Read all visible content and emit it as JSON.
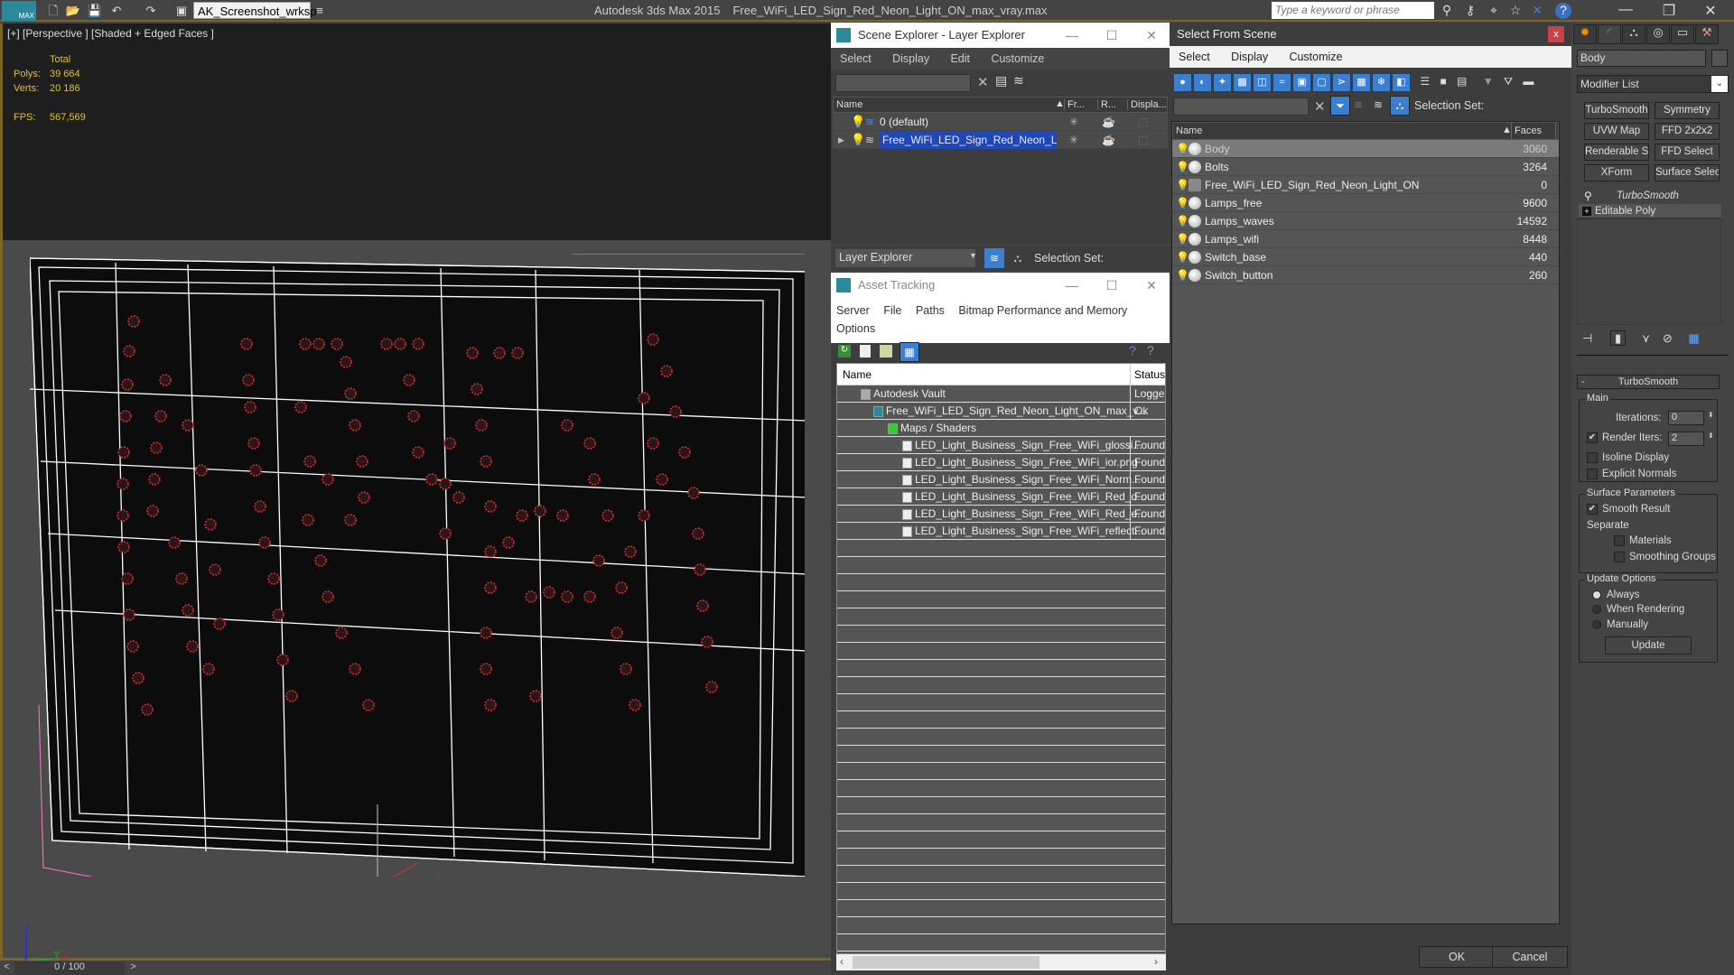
{
  "titlebar": {
    "logo_text": "MAX",
    "workspace": "AK_Screenshot_wrksp",
    "app_name": "Autodesk 3ds Max  2015",
    "file_name": "Free_WiFi_LED_Sign_Red_Neon_Light_ON_max_vray.max",
    "search_placeholder": "Type a keyword or phrase"
  },
  "viewport": {
    "label": "[+] [Perspective ] [Shaded + Edged Faces ]",
    "stats": {
      "total_label": "Total",
      "polys_label": "Polys:",
      "polys": "39 664",
      "verts_label": "Verts:",
      "verts": "20 186",
      "fps_label": "FPS:",
      "fps": "567,569"
    },
    "axis": {
      "x": "X",
      "y": "Y",
      "z": "Z"
    }
  },
  "timeline": {
    "prev": "<",
    "position": "0 / 100",
    "next": ">"
  },
  "scene_explorer": {
    "title": "Scene Explorer - Layer Explorer",
    "menu": [
      "Select",
      "Display",
      "Edit",
      "Customize"
    ],
    "columns": [
      "Name",
      "Fr...",
      "R...",
      "Displa..."
    ],
    "rows": [
      {
        "name": "0 (default)",
        "selected": false
      },
      {
        "name": "Free_WiFi_LED_Sign_Red_Neon_Ligh...",
        "selected": true
      }
    ],
    "explorer_type": "Layer Explorer",
    "selection_set_label": "Selection Set:"
  },
  "asset_tracking": {
    "title": "Asset Tracking",
    "menu": [
      "Server",
      "File",
      "Paths",
      "Bitmap Performance and Memory",
      "Options"
    ],
    "columns": [
      "Name",
      "Status"
    ],
    "rows": [
      {
        "name": "Autodesk Vault",
        "status": "Logge",
        "level": 0
      },
      {
        "name": "Free_WiFi_LED_Sign_Red_Neon_Light_ON_max_v...",
        "status": "Ok",
        "level": 1
      },
      {
        "name": "Maps / Shaders",
        "status": "",
        "level": 2
      },
      {
        "name": "LED_Light_Business_Sign_Free_WiFi_glossi...",
        "status": "Found",
        "level": 3
      },
      {
        "name": "LED_Light_Business_Sign_Free_WiFi_ior.png",
        "status": "Found",
        "level": 3
      },
      {
        "name": "LED_Light_Business_Sign_Free_WiFi_Norm...",
        "status": "Found",
        "level": 3
      },
      {
        "name": "LED_Light_Business_Sign_Free_WiFi_Red_d...",
        "status": "Found",
        "level": 3
      },
      {
        "name": "LED_Light_Business_Sign_Free_WiFi_Red_e...",
        "status": "Found",
        "level": 3
      },
      {
        "name": "LED_Light_Business_Sign_Free_WiFi_reflect...",
        "status": "Found",
        "level": 3
      }
    ]
  },
  "select_from_scene": {
    "title": "Select From Scene",
    "close": "x",
    "menu": [
      "Select",
      "Display",
      "Customize"
    ],
    "selection_set_label": "Selection Set:",
    "columns": [
      "Name",
      "Faces"
    ],
    "rows": [
      {
        "name": "Body",
        "faces": "3060",
        "selected": true
      },
      {
        "name": "Bolts",
        "faces": "3264"
      },
      {
        "name": "Free_WiFi_LED_Sign_Red_Neon_Light_ON",
        "faces": "0",
        "group": true
      },
      {
        "name": "Lamps_free",
        "faces": "9600"
      },
      {
        "name": "Lamps_waves",
        "faces": "14592"
      },
      {
        "name": "Lamps_wifi",
        "faces": "8448"
      },
      {
        "name": "Switch_base",
        "faces": "440"
      },
      {
        "name": "Switch_button",
        "faces": "260"
      }
    ],
    "ok": "OK",
    "cancel": "Cancel"
  },
  "command_panel": {
    "object_name": "Body",
    "modifier_list": "Modifier List",
    "modifier_buttons": [
      "TurboSmooth",
      "Symmetry",
      "UVW Map",
      "FFD 2x2x2",
      "Renderable Spline",
      "FFD Select",
      "XForm",
      "Surface Select"
    ],
    "stack": [
      "TurboSmooth",
      "Editable Poly"
    ],
    "rollout_title": "TurboSmooth",
    "main_group": "Main",
    "iterations_label": "Iterations:",
    "iterations": "0",
    "render_iters_label": "Render Iters:",
    "render_iters": "2",
    "render_iters_checked": true,
    "isoline_label": "Isoline Display",
    "explicit_normals_label": "Explicit Normals",
    "surface_group": "Surface Parameters",
    "smooth_result_label": "Smooth Result",
    "separate_label": "Separate",
    "materials_label": "Materials",
    "smoothing_groups_label": "Smoothing Groups",
    "update_group": "Update Options",
    "update_options": [
      "Always",
      "When Rendering",
      "Manually"
    ],
    "update_selected": "Always",
    "update_button": "Update"
  }
}
